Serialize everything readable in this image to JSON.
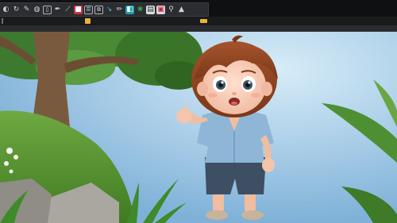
{
  "toolbar": {
    "tools": [
      {
        "icon": "adjust-icon",
        "glyph": "◐"
      },
      {
        "icon": "rotate-icon",
        "glyph": "↻"
      },
      {
        "icon": "brush-icon",
        "glyph": "✎"
      },
      {
        "icon": "eraser-icon",
        "glyph": "◍"
      },
      {
        "icon": "crop-icon",
        "glyph": "▯"
      },
      {
        "icon": "pen-icon",
        "glyph": "✒"
      },
      {
        "icon": "line-icon",
        "glyph": "⟋"
      },
      {
        "icon": "red-square-icon",
        "glyph": "■"
      },
      {
        "icon": "layer-icon",
        "glyph": "☰"
      },
      {
        "icon": "frame-icon",
        "glyph": "⧉"
      },
      {
        "icon": "arrow-icon",
        "glyph": "↘"
      },
      {
        "icon": "pencil-icon",
        "glyph": "✏"
      },
      {
        "icon": "teal-box-icon",
        "glyph": "◧"
      },
      {
        "icon": "leaf-icon",
        "glyph": "❀"
      },
      {
        "icon": "text-box-icon",
        "glyph": "▤"
      },
      {
        "icon": "stamp-icon",
        "glyph": "▣"
      },
      {
        "icon": "dropper-icon",
        "glyph": "⚲"
      },
      {
        "icon": "triangle-icon",
        "glyph": "▲"
      }
    ]
  },
  "colors": {
    "toolbar_bg": "#2b2d30",
    "accent_marker": "#e8b33a",
    "canvas_sky": "#a8cfe9"
  }
}
